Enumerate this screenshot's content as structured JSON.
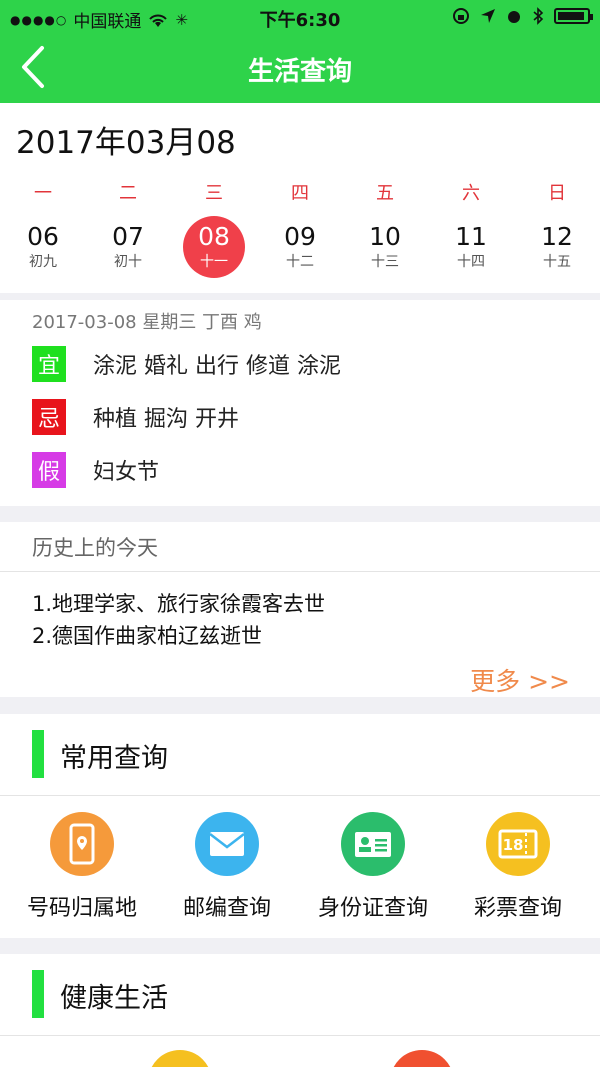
{
  "status_bar": {
    "signal": "●●●●○",
    "carrier": "中国联通",
    "time": "下午6:30"
  },
  "nav": {
    "title": "生活查询"
  },
  "calendar": {
    "date_title": "2017年03月08",
    "weekdays": [
      "一",
      "二",
      "三",
      "四",
      "五",
      "六",
      "日"
    ],
    "days": [
      {
        "num": "06",
        "lunar": "初九"
      },
      {
        "num": "07",
        "lunar": "初十"
      },
      {
        "num": "08",
        "lunar": "十一"
      },
      {
        "num": "09",
        "lunar": "十二"
      },
      {
        "num": "10",
        "lunar": "十三"
      },
      {
        "num": "11",
        "lunar": "十四"
      },
      {
        "num": "12",
        "lunar": "十五"
      }
    ],
    "selected_color": "#f0404a"
  },
  "almanac": {
    "header": "2017-03-08 星期三 丁酉 鸡",
    "rows": [
      {
        "tag": "宜",
        "text": "涂泥 婚礼 出行 修道 涂泥",
        "color": "#1fe01f"
      },
      {
        "tag": "忌",
        "text": "种植 掘沟 开井",
        "color": "#e8141c"
      },
      {
        "tag": "假",
        "text": "妇女节",
        "color": "#d63be6"
      }
    ]
  },
  "history": {
    "title": "历史上的今天",
    "items": [
      "1.地理学家、旅行家徐霞客去世",
      "2.德国作曲家柏辽兹逝世"
    ],
    "more": "更多 >>"
  },
  "common_queries": {
    "title": "常用查询",
    "items": [
      {
        "label": "号码归属地",
        "icon": "phone-location-icon",
        "color": "#f59a3b"
      },
      {
        "label": "邮编查询",
        "icon": "envelope-icon",
        "color": "#3cb4ee"
      },
      {
        "label": "身份证查询",
        "icon": "id-card-icon",
        "color": "#2bbd6c"
      },
      {
        "label": "彩票查询",
        "icon": "lottery-ticket-icon",
        "color": "#f5c020"
      }
    ]
  },
  "health": {
    "title": "健康生活",
    "icon_colors": [
      "#f5c020",
      "#f05030"
    ]
  },
  "colors": {
    "brand_green": "#2ed34a",
    "accent_orange": "#f08a4b"
  }
}
